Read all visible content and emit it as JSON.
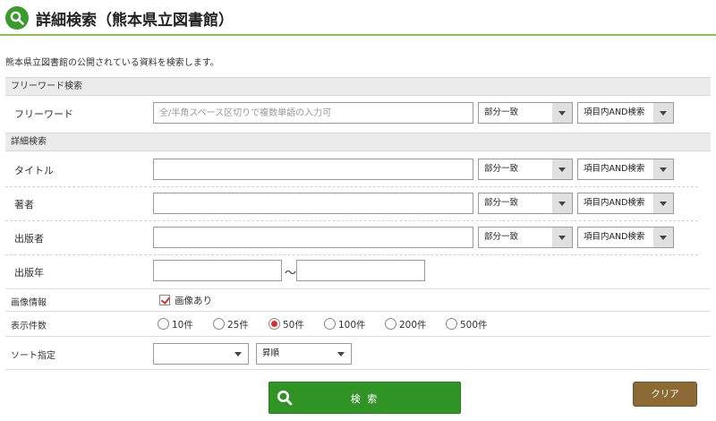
{
  "header": {
    "title": "詳細検索（熊本県立図書館）",
    "icon": "search-icon"
  },
  "intro": "熊本県立図書館の公開されている資料を検索します。",
  "freeword": {
    "section_title": "フリーワード検索",
    "label": "フリーワード",
    "placeholder": "全/半角スペース区切りで複数単語の入力可",
    "match": "部分一致",
    "logic": "項目内AND検索"
  },
  "detail": {
    "section_title": "詳細検索",
    "title_row": {
      "label": "タイトル",
      "value": "",
      "match": "部分一致",
      "logic": "項目内AND検索"
    },
    "author_row": {
      "label": "著者",
      "value": "",
      "match": "部分一致",
      "logic": "項目内AND検索"
    },
    "publisher_row": {
      "label": "出版者",
      "value": "",
      "match": "部分一致",
      "logic": "項目内AND検索"
    },
    "year_row": {
      "label": "出版年",
      "from": "",
      "to": "",
      "separator": "～"
    }
  },
  "image_info": {
    "label": "画像情報",
    "checkbox_label": "画像あり",
    "checked": true
  },
  "display_count": {
    "label": "表示件数",
    "options": [
      "10件",
      "25件",
      "50件",
      "100件",
      "200件",
      "500件"
    ],
    "selected": "50件"
  },
  "sort": {
    "label": "ソート指定",
    "field": "",
    "order": "昇順"
  },
  "buttons": {
    "search": "検 索",
    "clear": "クリア"
  },
  "colors": {
    "accent_green": "#2f9425",
    "header_line": "#8cc152",
    "clear_brown": "#8c6a36",
    "radio_check": "#d03030"
  }
}
